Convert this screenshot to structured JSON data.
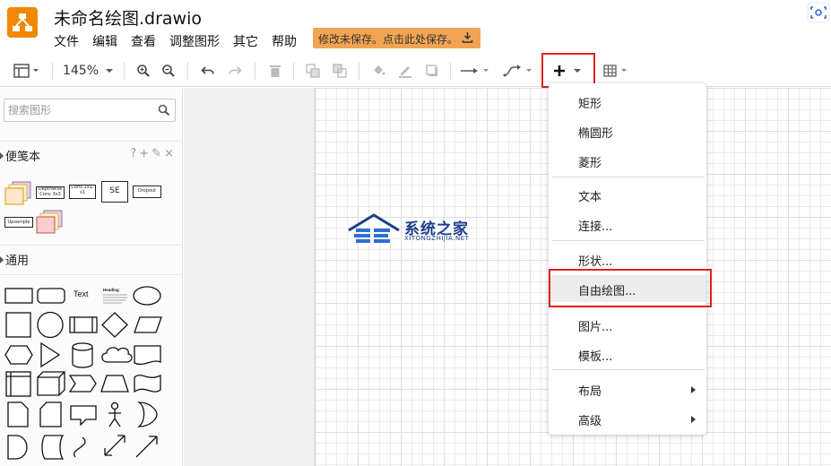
{
  "app": {
    "title": "未命名绘图.drawio",
    "menu": [
      "文件",
      "编辑",
      "查看",
      "调整图形",
      "其它",
      "帮助"
    ],
    "save_notice": "修改未保存。点击此处保存。"
  },
  "toolbar": {
    "zoom": "145%"
  },
  "sidebar": {
    "search_placeholder": "搜索图形",
    "scratchpad_title": "便笺本",
    "scratchpad_actions": [
      "?",
      "+",
      "✎",
      "×"
    ],
    "scratchpad_items": [
      "Dropout",
      "SE",
      "Conv 1x1, s1",
      "Depthwise Conv 3x3",
      "Upsample"
    ],
    "general_title": "通用",
    "text_shape_label": "Text",
    "heading_shape_label": "Heading"
  },
  "insert_menu": {
    "items": [
      {
        "label": "矩形"
      },
      {
        "label": "椭圆形"
      },
      {
        "label": "菱形"
      },
      {
        "label": "文本"
      },
      {
        "label": "连接..."
      },
      {
        "label": "形状..."
      },
      {
        "label": "自由绘图..."
      },
      {
        "label": "图片..."
      },
      {
        "label": "模板..."
      },
      {
        "label": "布局"
      },
      {
        "label": "高级"
      }
    ]
  },
  "watermark": {
    "title": "系统之家",
    "subtitle": "XITONGZHIJIA.NET"
  },
  "colors": {
    "accent": "#f08705",
    "save_banner": "#f2a453",
    "highlight_box": "#e02020",
    "watermark": "#1d3f8c"
  }
}
